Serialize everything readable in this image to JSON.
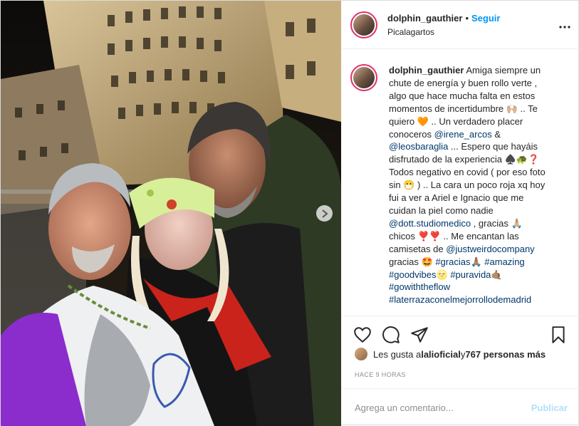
{
  "header": {
    "username": "dolphin_gauthier",
    "dot": "•",
    "follow_label": "Seguir",
    "location": "Picalagartos",
    "more_icon": "more-horizontal-icon"
  },
  "caption": {
    "username": "dolphin_gauthier",
    "text_1": " Amiga siempre un chute de energía y buen rollo verte , algo que hace mucha falta en estos momentos de incertidumbre 🙌🏼 .. Te quiero 🧡 .. Un verdadero placer conoceros ",
    "mention_1": "@irene_arcos",
    "text_2": " & ",
    "mention_2": "@leosbaraglia",
    "text_3": " ... Espero que hayáis disfrutado de la experiencia ♠️🐢❓ Todos negativo en covid ( por eso foto sin 😷 ) .. La cara un poco roja xq hoy fui a ver a Ariel e Ignacio que me cuidan la piel como nadie ",
    "mention_3": "@dott.studiomedico",
    "text_4": " , gracias 🙏🏼 chicos ❣️❣️ .. Me encantan las camisetas de ",
    "mention_4": "@justweirdocompany",
    "text_5": " gracias 🤩 ",
    "tag_1": "#gracias",
    "text_6": "🙏🏽 ",
    "tag_2": "#amazing",
    "text_7": " ",
    "tag_3": "#goodvibes",
    "text_8": "🌝 ",
    "tag_4": "#puravida",
    "text_9": "🤙🏽 ",
    "tag_5": "#gowiththeflow",
    "text_10": " ",
    "tag_6": "#laterrazaconelmejorrollodemadrid"
  },
  "actions": {
    "like_icon": "heart-icon",
    "comment_icon": "comment-icon",
    "share_icon": "share-icon",
    "save_icon": "bookmark-icon"
  },
  "likes": {
    "prefix": "Les gusta a ",
    "user": "lalioficial",
    "middle": " y ",
    "count": "767 personas más"
  },
  "timestamp": "HACE 9 HORAS",
  "comment_box": {
    "placeholder": "Agrega un comentario...",
    "publish_label": "Publicar"
  },
  "colors": {
    "link": "#00376b",
    "follow": "#0095f6",
    "publish_disabled": "#b2dffc"
  }
}
